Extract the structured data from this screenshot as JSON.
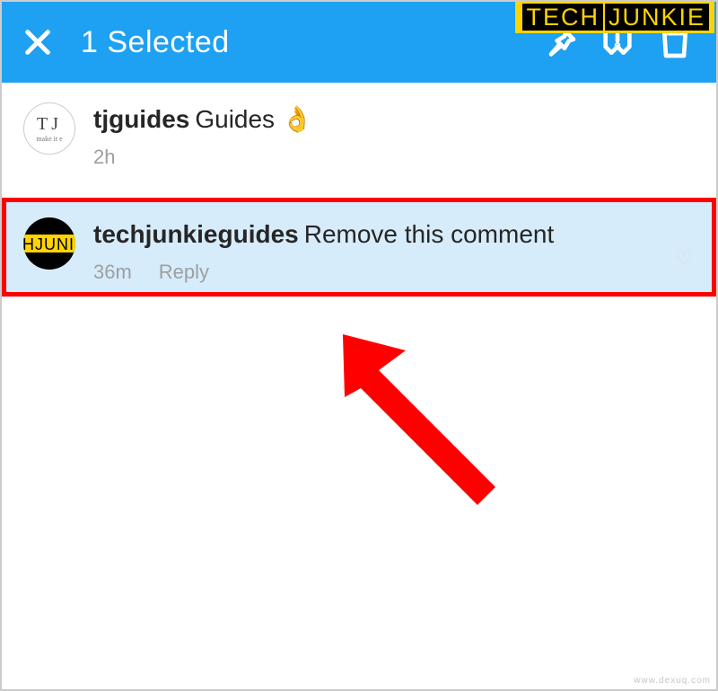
{
  "brand": {
    "part1": "TECH",
    "part2": "JUNKIE"
  },
  "header": {
    "title": "1 Selected"
  },
  "comments": [
    {
      "username": "tjguides",
      "text": "Guides",
      "emoji": "👌",
      "time": "2h",
      "avatarLine1": "TJ",
      "avatarLine2": "make it e"
    },
    {
      "username": "techjunkieguides",
      "text": "Remove this comment",
      "time": "36m",
      "reply": "Reply",
      "avatarText": "HJUNI"
    }
  ],
  "watermark": "www.dexuq.com"
}
